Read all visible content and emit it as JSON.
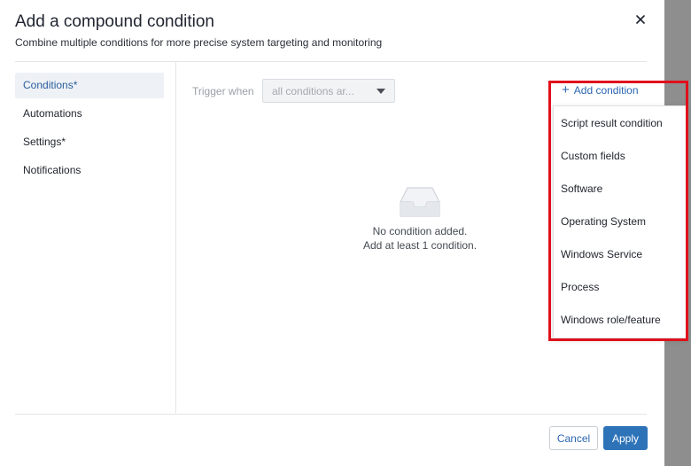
{
  "dialog": {
    "title": "Add a compound condition",
    "subtitle": "Combine multiple conditions for more precise system targeting and monitoring",
    "close_icon": "close-icon"
  },
  "nav": {
    "items": [
      {
        "label": "Conditions*",
        "active": true
      },
      {
        "label": "Automations",
        "active": false
      },
      {
        "label": "Settings*",
        "active": false
      },
      {
        "label": "Notifications",
        "active": false
      }
    ]
  },
  "trigger": {
    "label": "Trigger when",
    "selected": "all conditions ar..."
  },
  "empty_state": {
    "icon": "inbox-icon",
    "line1": "No condition added.",
    "line2": "Add at least 1 condition."
  },
  "add_condition": {
    "icon": "plus-icon",
    "label": "Add condition",
    "options": [
      "Script result condition",
      "Custom fields",
      "Software",
      "Operating System",
      "Windows Service",
      "Process",
      "Windows role/feature"
    ]
  },
  "footer": {
    "cancel_label": "Cancel",
    "apply_label": "Apply"
  },
  "colors": {
    "accent": "#2e73b8",
    "link": "#2b66b0",
    "highlight": "#e0101b",
    "overlay": "#8e8e8e"
  }
}
